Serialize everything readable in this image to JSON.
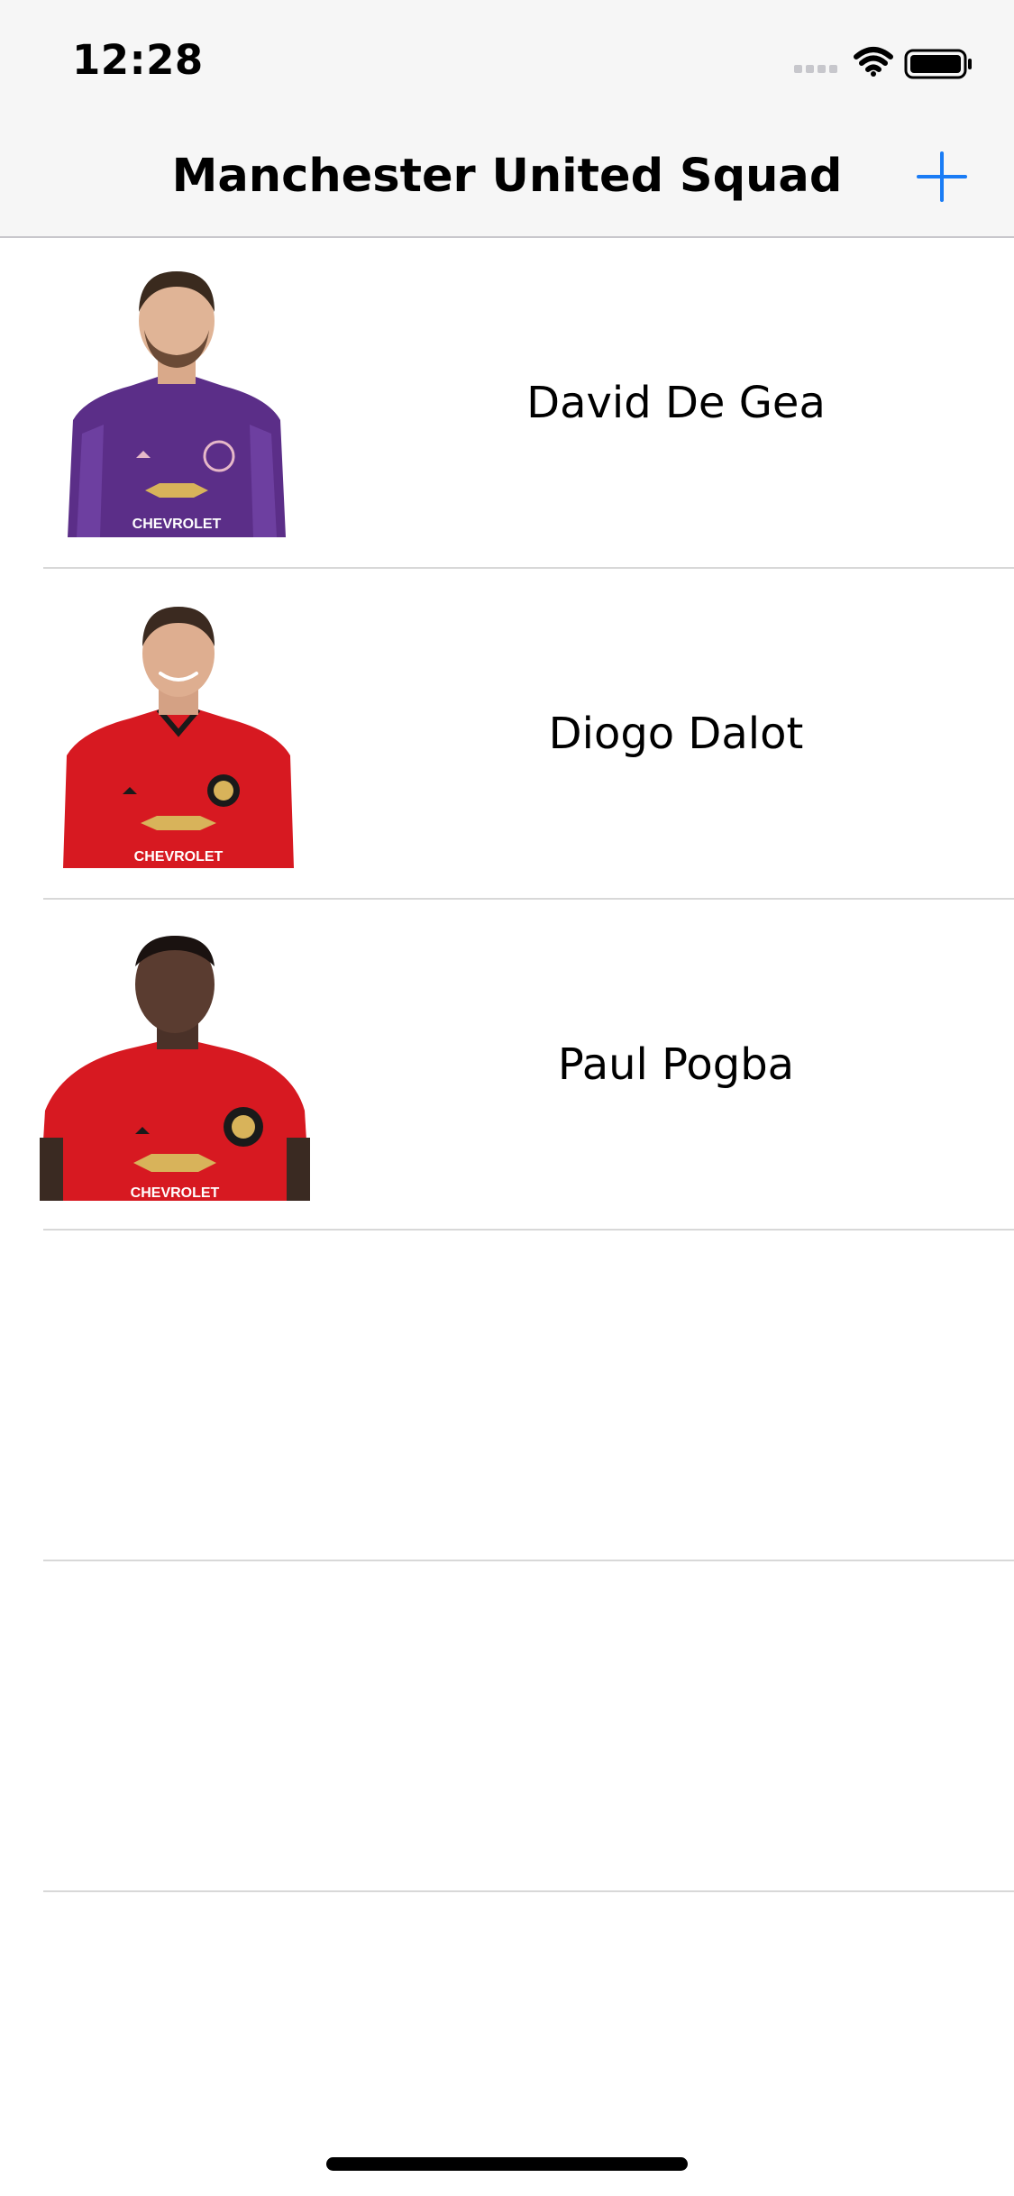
{
  "status_bar": {
    "time": "12:28",
    "icons": [
      "signal-bars-icon",
      "wifi-icon",
      "battery-icon"
    ]
  },
  "nav_bar": {
    "title": "Manchester United Squad",
    "add_icon": "plus-icon",
    "accent_color": "#1a7cf5"
  },
  "players": [
    {
      "name": "David De Gea",
      "photo_caption": "CHEVROLET",
      "kit_color": "#6a3d9a"
    },
    {
      "name": "Diogo Dalot",
      "photo_caption": "CHEVROLET",
      "kit_color": "#d71921"
    },
    {
      "name": "Paul Pogba",
      "photo_caption": "CHEVROLET",
      "kit_color": "#d71921"
    }
  ]
}
